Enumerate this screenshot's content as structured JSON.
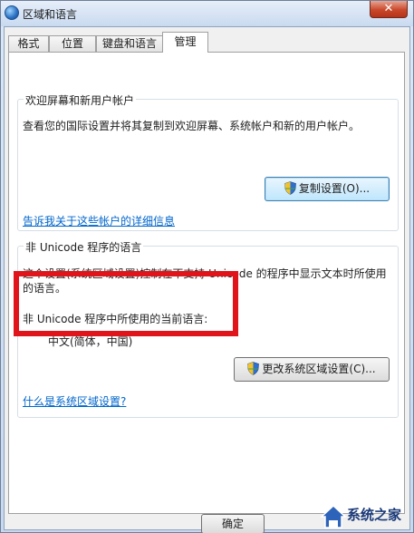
{
  "window": {
    "title": "区域和语言"
  },
  "tabs": [
    {
      "label": "格式"
    },
    {
      "label": "位置"
    },
    {
      "label": "键盘和语言"
    },
    {
      "label": "管理"
    }
  ],
  "welcome_group": {
    "title": "欢迎屏幕和新用户帐户",
    "description": "查看您的国际设置并将其复制到欢迎屏幕、系统帐户和新的用户帐户。",
    "copy_button": "复制设置(O)...",
    "link": "告诉我关于这些帐户的详细信息"
  },
  "unicode_group": {
    "title": "非 Unicode 程序的语言",
    "description_line1": "这个设置(系统区域设置)控制在不支持 Unicode 的程序中显示文本时所使用",
    "description_line2": "的语言。",
    "current_label": "非 Unicode 程序中所使用的当前语言:",
    "current_value": "中文(简体，中国)",
    "change_button": "更改系统区域设置(C)...",
    "link": "什么是系统区域设置?"
  },
  "footer": {
    "ok_button": "确定"
  },
  "watermark": {
    "text": "系统之家"
  },
  "colors": {
    "highlight": "#e0141b",
    "link": "#0066cc"
  }
}
